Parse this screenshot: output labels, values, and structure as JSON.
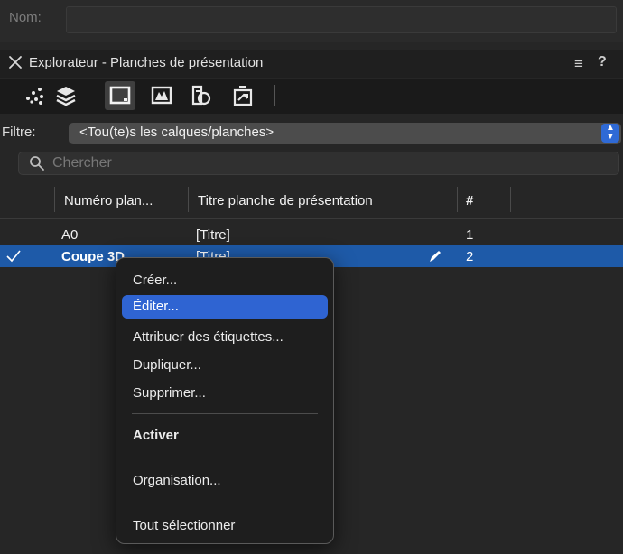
{
  "name_field": {
    "label": "Nom:",
    "value": ""
  },
  "panel": {
    "title": "Explorateur - Planches de présentation",
    "menu_glyph": "≡",
    "help_glyph": "?"
  },
  "toolbar": {
    "icons": [
      "classes-icon",
      "layers-icon",
      "sheet-layer-icon",
      "viewports-icon",
      "resources-icon",
      "symbols-icon"
    ],
    "active": "sheet-layer-icon"
  },
  "filter": {
    "label": "Filtre:",
    "value": "<Tou(te)s les calques/planches>"
  },
  "search": {
    "placeholder": "Chercher",
    "value": ""
  },
  "table": {
    "columns": [
      "Numéro plan...",
      "Titre planche de présentation",
      "#"
    ],
    "rows": [
      {
        "number": "A0",
        "title": "[Titre]",
        "order": "1",
        "active": false
      },
      {
        "number": "Coupe 3D",
        "title": "[Titre]",
        "order": "2",
        "active": true
      }
    ]
  },
  "context_menu": {
    "items": [
      {
        "label": "Créer...",
        "highlighted": false
      },
      {
        "label": "Éditer...",
        "highlighted": true
      },
      {
        "label": "Attribuer des étiquettes...",
        "highlighted": false
      },
      {
        "label": "Dupliquer...",
        "highlighted": false
      },
      {
        "label": "Supprimer...",
        "highlighted": false
      },
      {
        "label": "Activer",
        "bold": true
      },
      {
        "label": "Organisation..."
      },
      {
        "label": "Tout sélectionner"
      }
    ]
  },
  "colors": {
    "selection": "#1e5aa8",
    "menu_highlight": "#2f64d2",
    "select_arrow": "#2f6ad6"
  }
}
